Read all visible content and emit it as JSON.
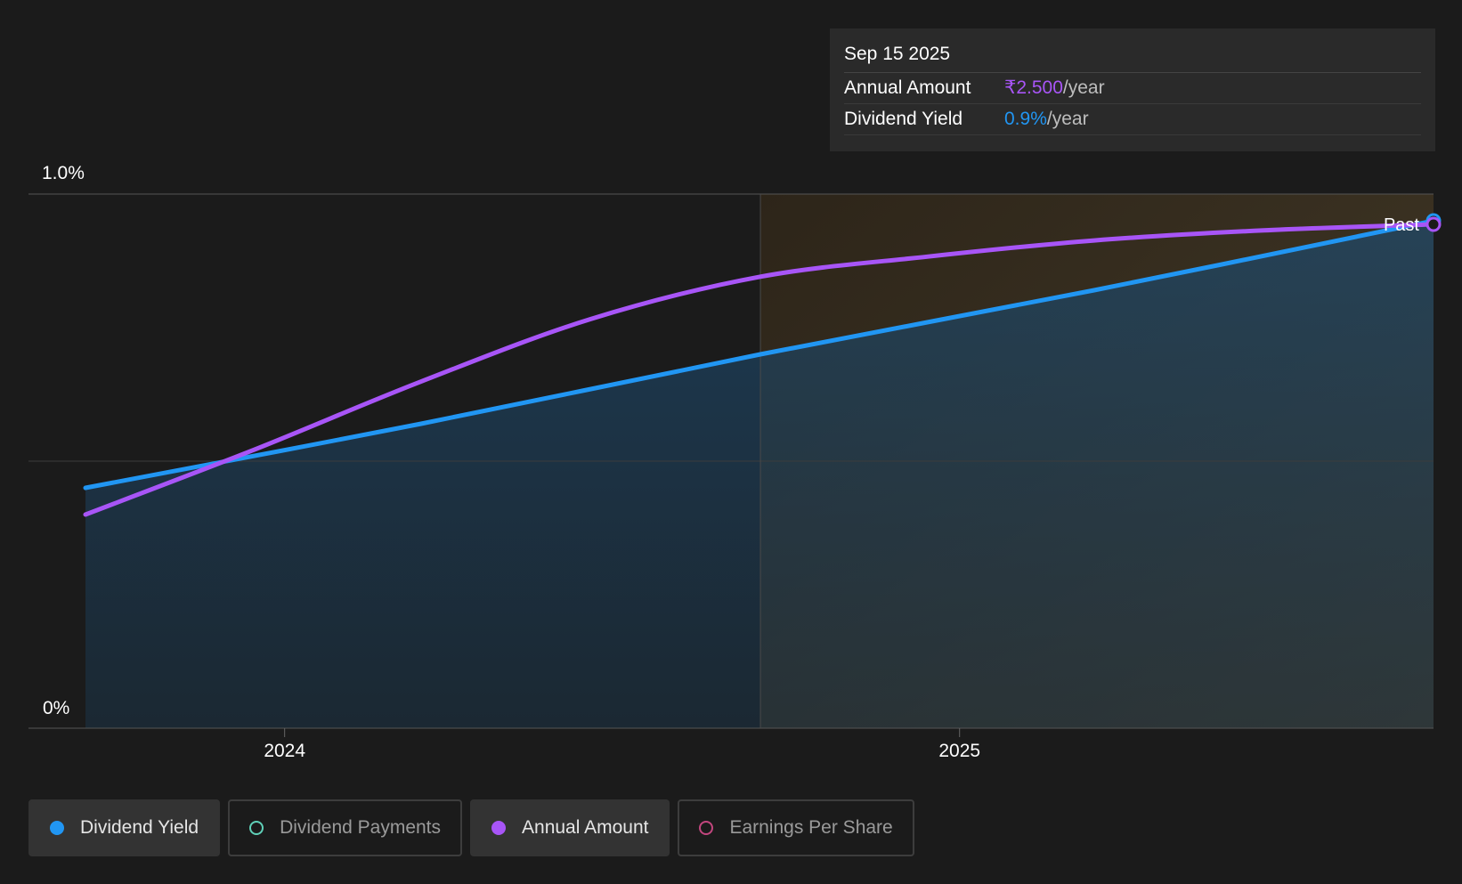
{
  "tooltip": {
    "date": "Sep 15 2025",
    "rows": [
      {
        "label": "Annual Amount",
        "value": "₹2.500",
        "unit": "/year",
        "color": "#a855f7"
      },
      {
        "label": "Dividend Yield",
        "value": "0.9%",
        "unit": "/year",
        "color": "#2196f3"
      }
    ]
  },
  "legend": [
    {
      "label": "Dividend Yield",
      "color": "#2196f3",
      "active": true,
      "filled": true
    },
    {
      "label": "Dividend Payments",
      "color": "#5fd0b8",
      "active": false,
      "filled": false
    },
    {
      "label": "Annual Amount",
      "color": "#a855f7",
      "active": true,
      "filled": true
    },
    {
      "label": "Earnings Per Share",
      "color": "#c2467e",
      "active": false,
      "filled": false
    }
  ],
  "chart_data": {
    "type": "line",
    "y_tick_labels": [
      "1.0%",
      "0%"
    ],
    "ylim": [
      0,
      1.0
    ],
    "x_tick_labels": [
      "2024",
      "2025"
    ],
    "x_ticks": [
      "2024-01-01",
      "2025-01-01"
    ],
    "xlim": [
      "2023-09-15",
      "2025-09-15"
    ],
    "past_boundary": "2024-09-15",
    "past_label": "Past",
    "grid": true,
    "series": [
      {
        "name": "Dividend Yield",
        "color": "#2196f3",
        "x": [
          "2023-09-15",
          "2024-03-15",
          "2024-09-15",
          "2025-03-15",
          "2025-09-15"
        ],
        "y": [
          0.45,
          0.57,
          0.7,
          0.82,
          0.95
        ]
      },
      {
        "name": "Annual Amount",
        "color": "#a855f7",
        "unit": "₹",
        "x": [
          "2023-09-15",
          "2023-12-15",
          "2024-03-15",
          "2024-06-15",
          "2024-09-15",
          "2024-12-15",
          "2025-03-15",
          "2025-06-15",
          "2025-09-15"
        ],
        "y": [
          1.06,
          1.38,
          1.72,
          2.03,
          2.24,
          2.34,
          2.42,
          2.47,
          2.5
        ],
        "ylim": [
          0,
          2.65
        ]
      }
    ]
  }
}
